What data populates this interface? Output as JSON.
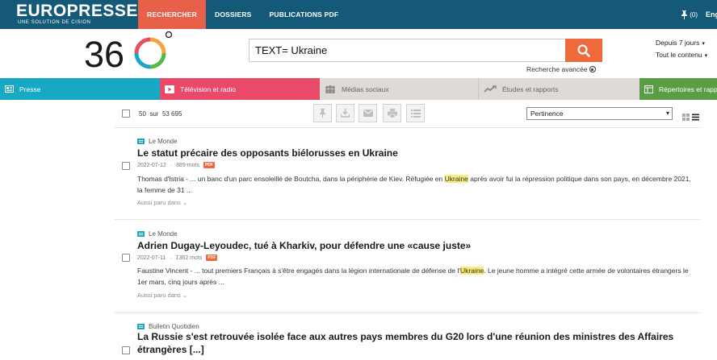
{
  "brand": {
    "name": "EUROPRESSE",
    "tagline": "UNE SOLUTION DE CISION"
  },
  "nav": {
    "items": [
      "RECHERCHER",
      "DOSSIERS",
      "PUBLICATIONS PDF"
    ],
    "active": "RECHERCHER"
  },
  "header_right": {
    "pin_count": "(0)",
    "language": "English"
  },
  "logo360": {
    "text": "360",
    "colors": [
      "#e94e5d",
      "#f4a340",
      "#56b947",
      "#1fa2c9"
    ]
  },
  "search": {
    "query": "TEXT= Ukraine",
    "advanced_label": "Recherche avancée",
    "period": "Depuis 7 jours",
    "scope": "Tout le contenu"
  },
  "categories": [
    {
      "label": "Presse",
      "icon": "newspaper-icon",
      "color": "#17a9c3"
    },
    {
      "label": "Télévision et radio",
      "icon": "play-icon",
      "color": "#ea4a6a"
    },
    {
      "label": "Médias sociaux",
      "icon": "people-icon",
      "color": "#dddad7"
    },
    {
      "label": "Études et rapports",
      "icon": "trend-icon",
      "color": "#dddad7"
    },
    {
      "label": "Répertoires et rapports",
      "icon": "directory-icon",
      "color": "#5a9d45"
    }
  ],
  "toolbar": {
    "count_shown": "50",
    "count_sep": "sur",
    "count_total": "53 695",
    "sort": "Pertinence",
    "tools": [
      "pin-icon",
      "download-icon",
      "email-icon",
      "print-icon",
      "list-icon"
    ]
  },
  "results": [
    {
      "source": "Le Monde",
      "title": "Le statut précaire des opposants biélorusses en Ukraine",
      "date": "2022-07-12",
      "words": "889 mots",
      "pdf": "PDF",
      "snippet_before": "Thomas d'Istria - ... un banc d'un parc ensoleillé de Boutcha, dans la périphérie de Kiev. Réfugiée en ",
      "highlight": "Ukraine",
      "snippet_after": " après avoir fui la répression politique dans son pays, en décembre 2021, la femme de 31 ...",
      "also": "Aussi paru dans"
    },
    {
      "source": "Le Monde",
      "title": "Adrien Dugay-Leyoudec, tué à Kharkiv, pour défendre une «cause juste»",
      "date": "2022-07-11",
      "words": "1362 mots",
      "pdf": "PDF",
      "snippet_before": "Faustine Vincent - ... tout premiers Français à s'être engagés dans la légion internationale de défense de l'",
      "highlight": "Ukraine",
      "snippet_after": ". Le jeune homme a intégré cette armée de volontaires étrangers le 1er mars, cinq jours après ...",
      "also": "Aussi paru dans"
    },
    {
      "source": "Bulletin Quotidien",
      "title": "La Russie s'est retrouvée isolée face aux autres pays membres du G20 lors d'une réunion des ministres des Affaires étrangères [...]"
    }
  ]
}
